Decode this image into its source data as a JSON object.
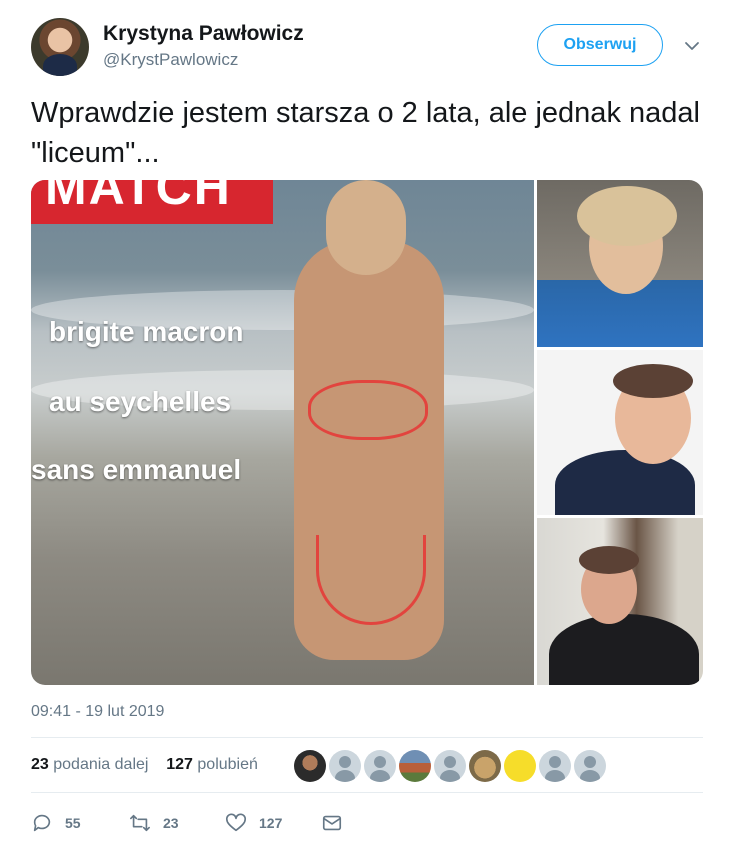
{
  "author": {
    "name": "Krystyna Pawłowicz",
    "handle": "@KrystPawlowicz"
  },
  "header": {
    "follow_label": "Obserwuj"
  },
  "tweet": {
    "text": "Wprawdzie jestem starsza o 2 lata, ale jednak nadal \"liceum\"...",
    "timestamp": "09:41 - 19 lut 2019"
  },
  "media": {
    "banner_text": "MATCH",
    "captions": [
      "brigite macron",
      "au seychelles",
      "sans emmanuel"
    ]
  },
  "stats": {
    "retweets_count": "23",
    "retweets_label": "podania dalej",
    "likes_count": "127",
    "likes_label": "polubień"
  },
  "actions": {
    "reply_count": "55",
    "retweet_count": "23",
    "like_count": "127"
  },
  "icons": {
    "reply": "reply-icon",
    "retweet": "retweet-icon",
    "like": "heart-icon",
    "dm": "envelope-icon",
    "caret": "chevron-down-icon"
  },
  "colors": {
    "accent": "#1da1f2",
    "muted": "#657786",
    "text": "#14171a"
  }
}
